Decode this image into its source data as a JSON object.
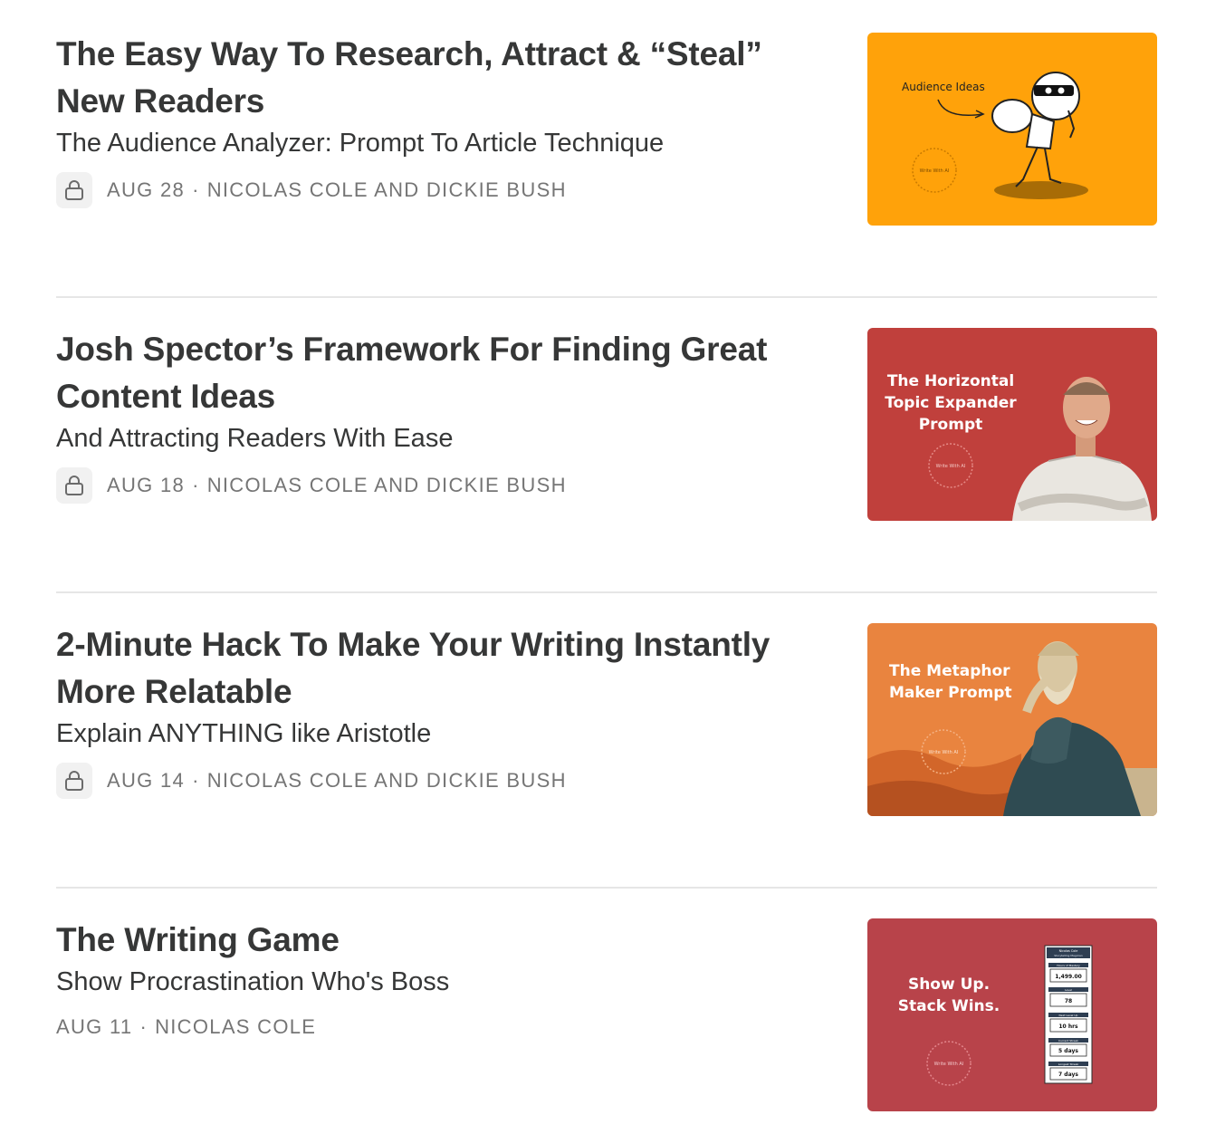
{
  "posts": [
    {
      "title": "The Easy Way To Research, Attract & “Steal” New Readers",
      "subtitle": "The Audience Analyzer: Prompt To Article Technique",
      "date": "AUG 28",
      "authors": "NICOLAS COLE AND DICKIE BUSH",
      "locked": true,
      "thumbnail": {
        "bg": "#ffa20a",
        "label": "Audience Ideas",
        "seal": "Write With AI"
      }
    },
    {
      "title": "Josh Spector’s Framework For Finding Great Content Ideas",
      "subtitle": "And Attracting Readers With Ease",
      "date": "AUG 18",
      "authors": "NICOLAS COLE AND DICKIE BUSH",
      "locked": true,
      "thumbnail": {
        "bg": "#c0403c",
        "label": "The Horizontal Topic Expander Prompt",
        "seal": "Write With AI"
      }
    },
    {
      "title": "2-Minute Hack To Make Your Writing Instantly More Relatable",
      "subtitle": "Explain ANYTHING like Aristotle",
      "date": "AUG 14",
      "authors": "NICOLAS COLE AND DICKIE BUSH",
      "locked": true,
      "thumbnail": {
        "bg": "#e9843f",
        "label": "The Metaphor Maker Prompt",
        "seal": "Write With AI"
      }
    },
    {
      "title": "The Writing Game",
      "subtitle": "Show Procrastination Who's Boss",
      "date": "AUG 11",
      "authors": "NICOLAS COLE",
      "locked": false,
      "thumbnail": {
        "bg": "#b8434a",
        "label": "Show Up. Stack Wins.",
        "seal": "Write With AI",
        "card": {
          "name": "Nicolas Cole",
          "subtitle": "Storytelling Magician",
          "stats": [
            {
              "label": "Hours of Mastery",
              "value": "1,499.00"
            },
            {
              "label": "Level",
              "value": "78"
            },
            {
              "label": "Next Level Up",
              "value": "10 hrs"
            },
            {
              "label": "Current Streak",
              "value": "5 days"
            },
            {
              "label": "Longest Streak",
              "value": "7 days"
            }
          ]
        }
      }
    }
  ],
  "separator": "·",
  "icons": {
    "lock": "lock-icon"
  }
}
